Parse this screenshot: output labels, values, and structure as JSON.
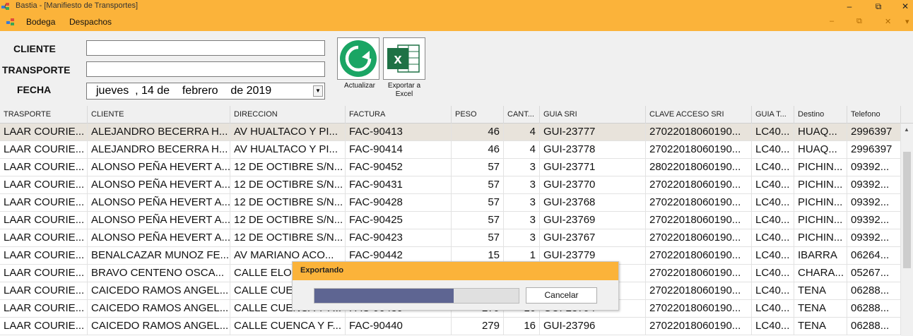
{
  "window": {
    "title": "Bastia - [Manifiesto de Transportes]",
    "minimize": "–",
    "maximize": "⧉",
    "close": "✕"
  },
  "menu": {
    "items": [
      "Bodega",
      "Despachos"
    ],
    "mdi_min": "–",
    "mdi_restore": "⧉",
    "mdi_close": "✕",
    "mdi_arrow": "▾"
  },
  "form": {
    "cliente_label": "CLIENTE",
    "cliente_value": "",
    "transporte_label": "TRANSPORTE",
    "transporte_value": "",
    "fecha_label": "FECHA",
    "fecha_value": "jueves  , 14 de    febrero    de 2019"
  },
  "toolbar": {
    "refresh_label": "Actualizar",
    "export_label_1": "Exportar a",
    "export_label_2": "Excel"
  },
  "grid": {
    "columns": [
      "TRASPORTE",
      "CLIENTE",
      "DIRECCION",
      "FACTURA",
      "PESO",
      "CANT...",
      "GUIA SRI",
      "CLAVE ACCESO SRI",
      "GUIA T...",
      "Destino",
      "Telefono"
    ],
    "rows": [
      [
        "LAAR COURIE...",
        "ALEJANDRO BECERRA H...",
        "AV HUALTACO Y PI...",
        "FAC-90413",
        "46",
        "4",
        "GUI-23777",
        "27022018060190...",
        "LC40...",
        "HUAQ...",
        "2996397"
      ],
      [
        "LAAR COURIE...",
        "ALEJANDRO BECERRA H...",
        "AV HUALTACO Y PI...",
        "FAC-90414",
        "46",
        "4",
        "GUI-23778",
        "27022018060190...",
        "LC40...",
        "HUAQ...",
        "2996397"
      ],
      [
        "LAAR COURIE...",
        "ALONSO PEÑA HEVERT A...",
        "12 DE OCTIBRE S/N...",
        "FAC-90452",
        "57",
        "3",
        "GUI-23771",
        "28022018060190...",
        "LC40...",
        "PICHIN...",
        "09392..."
      ],
      [
        "LAAR COURIE...",
        "ALONSO PEÑA HEVERT A...",
        "12 DE OCTIBRE S/N...",
        "FAC-90431",
        "57",
        "3",
        "GUI-23770",
        "27022018060190...",
        "LC40...",
        "PICHIN...",
        "09392..."
      ],
      [
        "LAAR COURIE...",
        "ALONSO PEÑA HEVERT A...",
        "12 DE OCTIBRE S/N...",
        "FAC-90428",
        "57",
        "3",
        "GUI-23768",
        "27022018060190...",
        "LC40...",
        "PICHIN...",
        "09392..."
      ],
      [
        "LAAR COURIE...",
        "ALONSO PEÑA HEVERT A...",
        "12 DE OCTIBRE S/N...",
        "FAC-90425",
        "57",
        "3",
        "GUI-23769",
        "27022018060190...",
        "LC40...",
        "PICHIN...",
        "09392..."
      ],
      [
        "LAAR COURIE...",
        "ALONSO PEÑA HEVERT A...",
        "12 DE OCTIBRE S/N...",
        "FAC-90423",
        "57",
        "3",
        "GUI-23767",
        "27022018060190...",
        "LC40...",
        "PICHIN...",
        "09392..."
      ],
      [
        "LAAR COURIE...",
        "BENALCAZAR MUNOZ FE...",
        "AV MARIANO ACO...",
        "FAC-90442",
        "15",
        "1",
        "GUI-23779",
        "27022018060190...",
        "LC40...",
        "IBARRA",
        "06264..."
      ],
      [
        "LAAR COURIE...",
        "BRAVO CENTENO OSCA...",
        "CALLE ELOY",
        "",
        "",
        "",
        "",
        "27022018060190...",
        "LC40...",
        "CHARA...",
        "05267..."
      ],
      [
        "LAAR COURIE...",
        "CAICEDO RAMOS ANGEL...",
        "CALLE CUENCA",
        "",
        "",
        "",
        "",
        "27022018060190...",
        "LC40...",
        "TENA",
        "06288..."
      ],
      [
        "LAAR COURIE...",
        "CAICEDO RAMOS ANGEL...",
        "CALLE CUENCA Y F...",
        "FAC-90430",
        "279",
        "16",
        "GUI-23794",
        "27022018060190...",
        "LC40...",
        "TENA",
        "06288..."
      ],
      [
        "LAAR COURIE...",
        "CAICEDO RAMOS ANGEL...",
        "CALLE CUENCA Y F...",
        "FAC-90440",
        "279",
        "16",
        "GUI-23796",
        "27022018060190...",
        "LC40...",
        "TENA",
        "06288..."
      ]
    ]
  },
  "dialog": {
    "title": "Exportando",
    "cancel_label": "Cancelar",
    "progress": 0.68
  },
  "colors": {
    "accent": "#fbb33a",
    "progress": "#5e6592",
    "excel_green": "#1e7145",
    "refresh_green": "#1aa564"
  }
}
